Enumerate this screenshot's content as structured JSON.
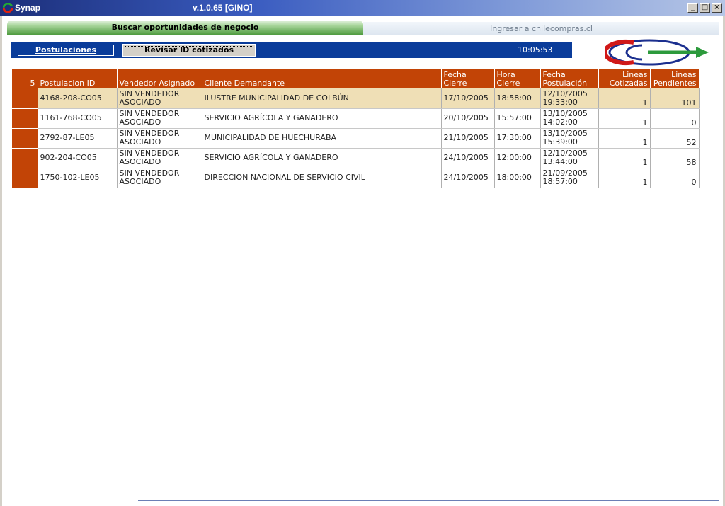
{
  "window": {
    "app_name": "Synap",
    "version_label": "v.1.0.65 [GINO]",
    "controls": {
      "minimize": "_",
      "maximize": "□",
      "close": "×"
    }
  },
  "tabs": {
    "main": "Buscar oportunidades de negocio",
    "secondary": "Ingresar a chilecompras.cl"
  },
  "toolbar": {
    "postulaciones": "Postulaciones",
    "revisar": "Revisar ID cotizados",
    "clock": "10:05:53"
  },
  "table": {
    "headers": {
      "count": "5",
      "postulacion_id": "Postulacion ID",
      "vendedor": "Vendedor Asignado",
      "cliente": "Cliente Demandante",
      "fecha_cierre_1": "Fecha",
      "fecha_cierre_2": "Cierre",
      "hora_cierre_1": "Hora",
      "hora_cierre_2": "Cierre",
      "fecha_post_1": "Fecha",
      "fecha_post_2": "Postulación",
      "lineas_cot_1": "Lineas",
      "lineas_cot_2": "Cotizadas",
      "lineas_pend_1": "Lineas",
      "lineas_pend_2": "Pendientes"
    },
    "rows": [
      {
        "id": "4168-208-CO05",
        "vendedor_1": "SIN VENDEDOR",
        "vendedor_2": "ASOCIADO",
        "cliente": "ILUSTRE MUNICIPALIDAD DE COLBÚN",
        "fecha_cierre": "17/10/2005",
        "hora_cierre": "18:58:00",
        "fecha_post": "12/10/2005",
        "hora_post": "19:33:00",
        "cotizadas": "1",
        "pendientes": "101"
      },
      {
        "id": "1161-768-CO05",
        "vendedor_1": "SIN VENDEDOR",
        "vendedor_2": "ASOCIADO",
        "cliente": "SERVICIO AGRÍCOLA Y GANADERO",
        "fecha_cierre": "20/10/2005",
        "hora_cierre": "15:57:00",
        "fecha_post": "13/10/2005",
        "hora_post": "14:02:00",
        "cotizadas": "1",
        "pendientes": "0"
      },
      {
        "id": "2792-87-LE05",
        "vendedor_1": "SIN VENDEDOR",
        "vendedor_2": "ASOCIADO",
        "cliente": "MUNICIPALIDAD DE HUECHURABA",
        "fecha_cierre": "21/10/2005",
        "hora_cierre": "17:30:00",
        "fecha_post": "13/10/2005",
        "hora_post": "15:39:00",
        "cotizadas": "1",
        "pendientes": "52"
      },
      {
        "id": "902-204-CO05",
        "vendedor_1": "SIN VENDEDOR",
        "vendedor_2": "ASOCIADO",
        "cliente": "SERVICIO AGRÍCOLA Y GANADERO",
        "fecha_cierre": "24/10/2005",
        "hora_cierre": "12:00:00",
        "fecha_post": "12/10/2005",
        "hora_post": "13:44:00",
        "cotizadas": "1",
        "pendientes": "58"
      },
      {
        "id": "1750-102-LE05",
        "vendedor_1": "SIN VENDEDOR",
        "vendedor_2": "ASOCIADO",
        "cliente": "DIRECCIÓN NACIONAL DE SERVICIO CIVIL",
        "fecha_cierre": "24/10/2005",
        "hora_cierre": "18:00:00",
        "fecha_post": "21/09/2005",
        "hora_post": "18:57:00",
        "cotizadas": "1",
        "pendientes": "0"
      }
    ]
  },
  "colors": {
    "header_bg": "#c24406",
    "selected_row": "#efdfb6",
    "toolbar_bg": "#0a3c9a"
  }
}
